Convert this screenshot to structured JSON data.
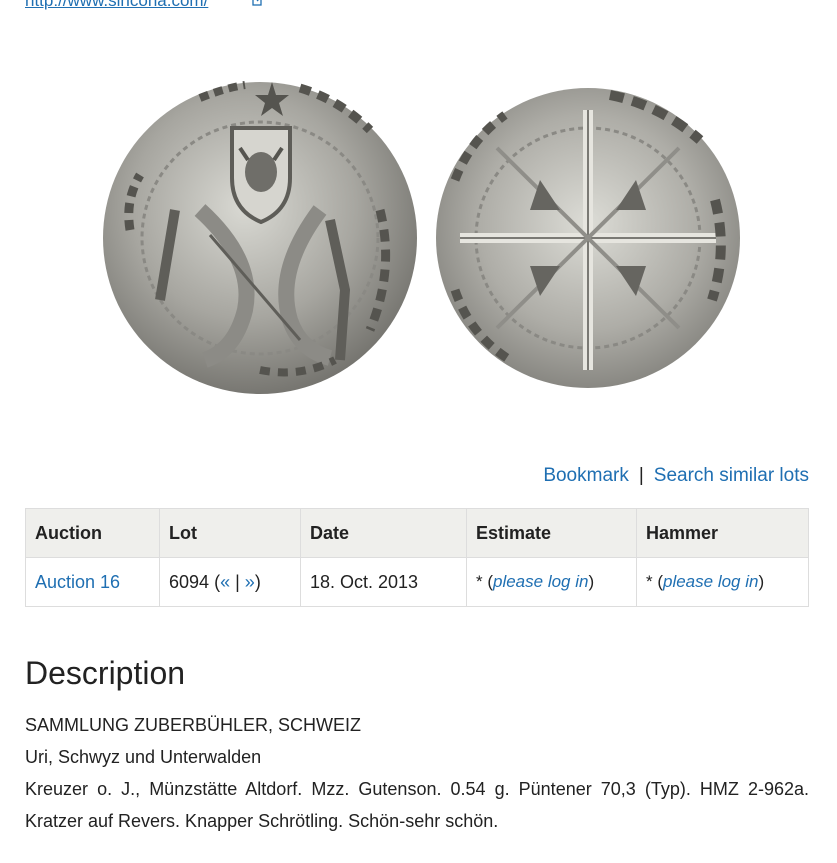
{
  "top_link": {
    "text": "http://www.sincona.com/"
  },
  "coin_images": {
    "obverse": "coin-obverse",
    "reverse": "coin-reverse"
  },
  "actions": {
    "bookmark": "Bookmark",
    "separator": "|",
    "search_similar": "Search similar lots"
  },
  "table": {
    "headers": [
      "Auction",
      "Lot",
      "Date",
      "Estimate",
      "Hammer"
    ],
    "row": {
      "auction": "Auction 16",
      "lot_number": "6094",
      "lot_open": "(",
      "prev": "«",
      "lot_sep": "|",
      "next": "»",
      "lot_close": ")",
      "date": "18. Oct. 2013",
      "estimate_prefix": "* (",
      "estimate_link": "please log in",
      "estimate_suffix": ")",
      "hammer_prefix": "* (",
      "hammer_link": "please log in",
      "hammer_suffix": ")"
    }
  },
  "description": {
    "title": "Description",
    "collection": "SAMMLUNG ZUBERBÜHLER, SCHWEIZ",
    "region": "Uri, Schwyz und Unterwalden",
    "text": "Kreuzer o. J., Münzstätte Altdorf. Mzz. Gutenson. 0.54 g. Püntener 70,3 (Typ). HMZ 2-962a. Kratzer auf Revers. Knapper Schrötling. Schön-sehr schön."
  }
}
